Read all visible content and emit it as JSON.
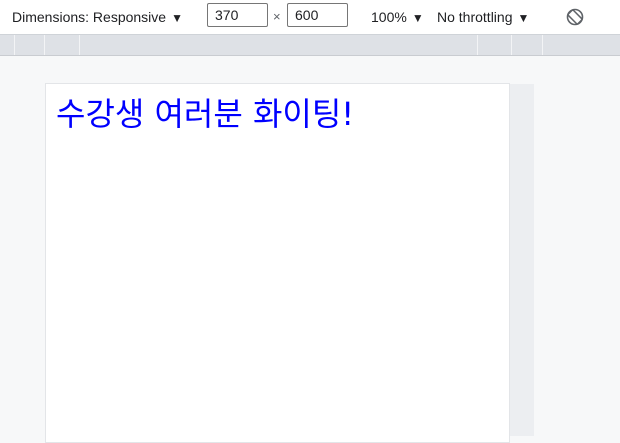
{
  "toolbar": {
    "dimensions_label": "Dimensions: Responsive",
    "width_value": "370",
    "times_symbol": "×",
    "height_value": "600",
    "zoom_label": "100%",
    "throttling_label": "No throttling",
    "caret": "▼",
    "rotate_icon": "rotate-icon"
  },
  "page": {
    "heading": "수강생 여러분 화이팅!",
    "heading_color": "#0000ff"
  }
}
